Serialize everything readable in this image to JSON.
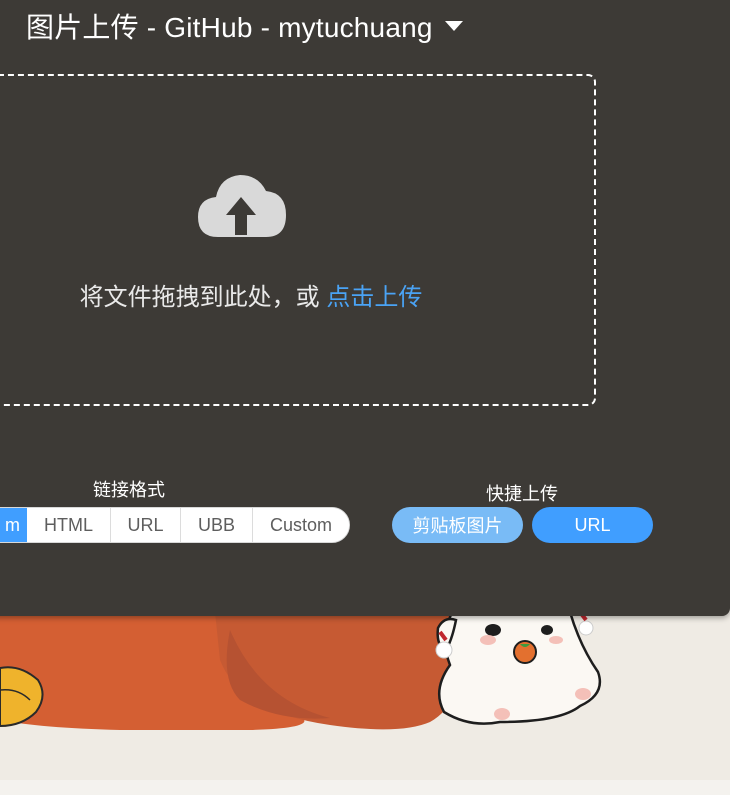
{
  "header": {
    "title": "图片上传 - GitHub - mytuchuang"
  },
  "dropzone": {
    "text": "将文件拖拽到此处，或",
    "link": "点击上传",
    "icon": "cloud-upload-icon"
  },
  "link_format": {
    "label": "链接格式",
    "options": [
      "m",
      "HTML",
      "URL",
      "UBB",
      "Custom"
    ],
    "selected_index": 0
  },
  "quick_upload": {
    "label": "快捷上传",
    "clipboard_label": "剪贴板图片",
    "url_label": "URL"
  },
  "colors": {
    "panel": "#3d3a36",
    "accent": "#409eff",
    "accent_light": "#79bbf6",
    "link": "#4aa3f5"
  }
}
